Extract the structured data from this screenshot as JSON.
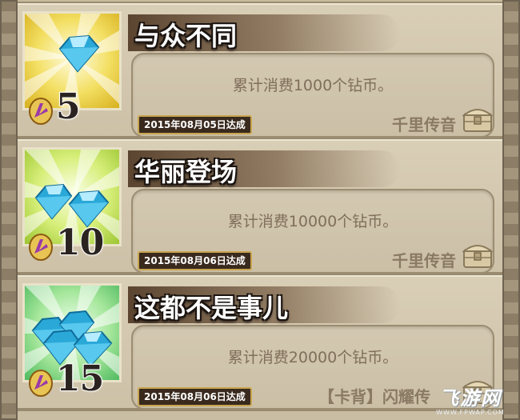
{
  "rows": [
    {
      "title": "与众不同",
      "description": "累计消费1000个钻币。",
      "count": "5",
      "date": "2015年08月05日达成",
      "reward": "千里传音",
      "icon_bg": [
        "#fff9c8",
        "#f4e169",
        "#e6c72e"
      ],
      "icon": "single-diamond-icon"
    },
    {
      "title": "华丽登场",
      "description": "累计消费10000个钻币。",
      "count": "10",
      "date": "2015年08月06日达成",
      "reward": "千里传音",
      "icon_bg": [
        "#f7ffd6",
        "#d9ef7a",
        "#a9cf3a"
      ],
      "icon": "two-diamonds-icon"
    },
    {
      "title": "这都不是事儿",
      "description": "累计消费20000个钻币。",
      "count": "15",
      "date": "2015年08月06日达成",
      "reward": "【卡背】闪耀传",
      "icon_bg": [
        "#eaffe6",
        "#a9e9a0",
        "#5fc46a"
      ],
      "icon": "diamond-pile-icon"
    }
  ],
  "watermark": {
    "main": "飞游网",
    "sub": "WWW.FPWAP.COM"
  }
}
